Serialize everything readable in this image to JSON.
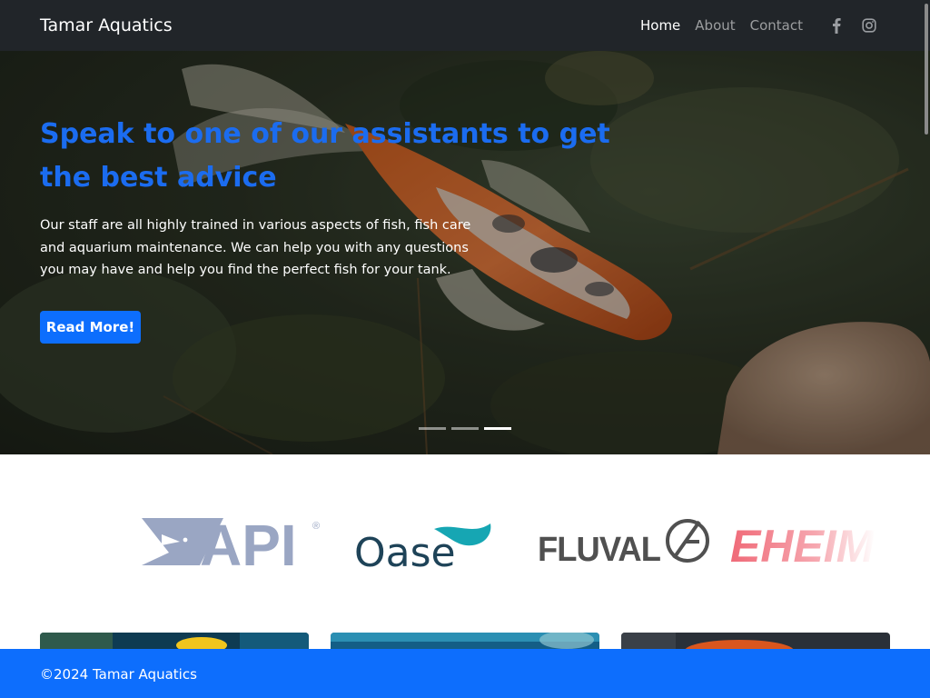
{
  "navbar": {
    "brand": "Tamar Aquatics",
    "links": [
      {
        "label": "Home",
        "active": true
      },
      {
        "label": "About",
        "active": false
      },
      {
        "label": "Contact",
        "active": false
      }
    ],
    "social_icons": [
      "facebook-icon",
      "instagram-icon"
    ]
  },
  "hero": {
    "title": "Speak to one of our assistants to get the best advice",
    "text": "Our staff are all highly trained in various aspects of fish, fish care and aquarium maintenance. We can help you with any questions you may have and help you find the perfect fish for your tank.",
    "button_label": "Read More!",
    "slides": 3,
    "active_slide": 3
  },
  "brands": {
    "logos": [
      {
        "name": "API",
        "text": "API",
        "mark": "®"
      },
      {
        "name": "Oase",
        "text": "Oase"
      },
      {
        "name": "Fluval",
        "text": "FLUVAL"
      },
      {
        "name": "Eheim",
        "text": "EHEIM"
      }
    ]
  },
  "footer": {
    "text": "©2024 Tamar Aquatics"
  },
  "colors": {
    "navbar_bg": "#212529",
    "primary": "#0d6efd",
    "hero_title": "#1b6cf0",
    "api_logo": "#9aa6c3",
    "oase_text": "#1e4358",
    "oase_wave": "#16a6b3",
    "fluval_logo": "#505050",
    "eheim_logo": "#f06a78"
  }
}
